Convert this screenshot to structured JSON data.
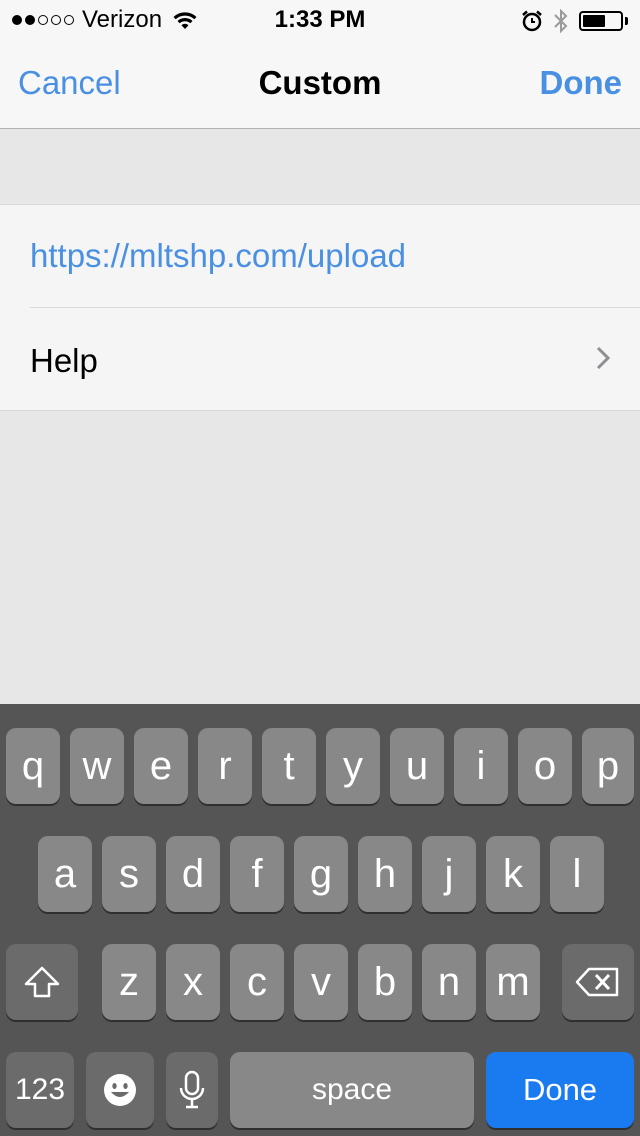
{
  "status_bar": {
    "signal_dots": [
      true,
      true,
      false,
      false,
      false
    ],
    "carrier": "Verizon",
    "time": "1:33 PM",
    "battery_level": 0.6
  },
  "nav": {
    "cancel_label": "Cancel",
    "title": "Custom",
    "done_label": "Done"
  },
  "form": {
    "url_value": "https://mltshp.com/upload",
    "help_label": "Help"
  },
  "colors": {
    "accent": "#4a90e2",
    "keyboard_bg": "#555555",
    "key_bg": "#888888",
    "done_key": "#1a7bf1"
  },
  "keyboard": {
    "row1": [
      "q",
      "w",
      "e",
      "r",
      "t",
      "y",
      "u",
      "i",
      "o",
      "p"
    ],
    "row2": [
      "a",
      "s",
      "d",
      "f",
      "g",
      "h",
      "j",
      "k",
      "l"
    ],
    "row3": [
      "z",
      "x",
      "c",
      "v",
      "b",
      "n",
      "m"
    ],
    "numbers_label": "123",
    "space_label": "space",
    "done_label": "Done"
  }
}
